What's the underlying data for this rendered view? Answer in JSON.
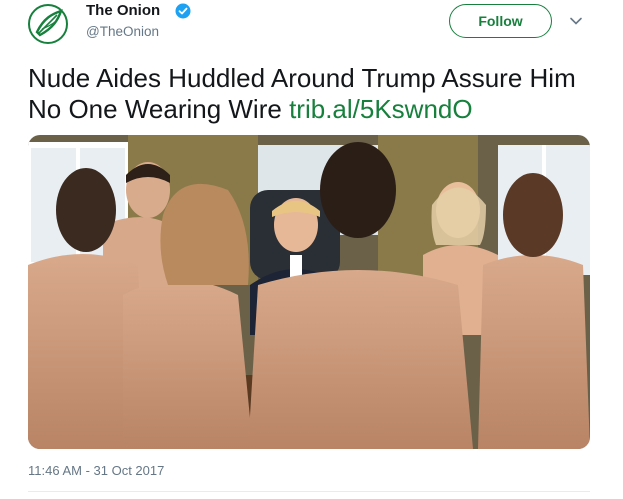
{
  "account": {
    "name": "The Onion",
    "handle": "@TheOnion",
    "avatar_icon": "onion-logo-icon",
    "verified_icon": "verified-badge-icon"
  },
  "follow_label": "Follow",
  "menu_icon": "chevron-down-icon",
  "tweet": {
    "text": "Nude Aides Huddled Around Trump Assure Him No One Wearing Wire",
    "link": "trib.al/5KswndO"
  },
  "photo_icon": "tweet-photo",
  "timestamp": "11:46 AM - 31 Oct 2017",
  "colors": {
    "brand_green": "#17803d",
    "verified_blue": "#1da1f2",
    "muted_text": "#657786"
  }
}
